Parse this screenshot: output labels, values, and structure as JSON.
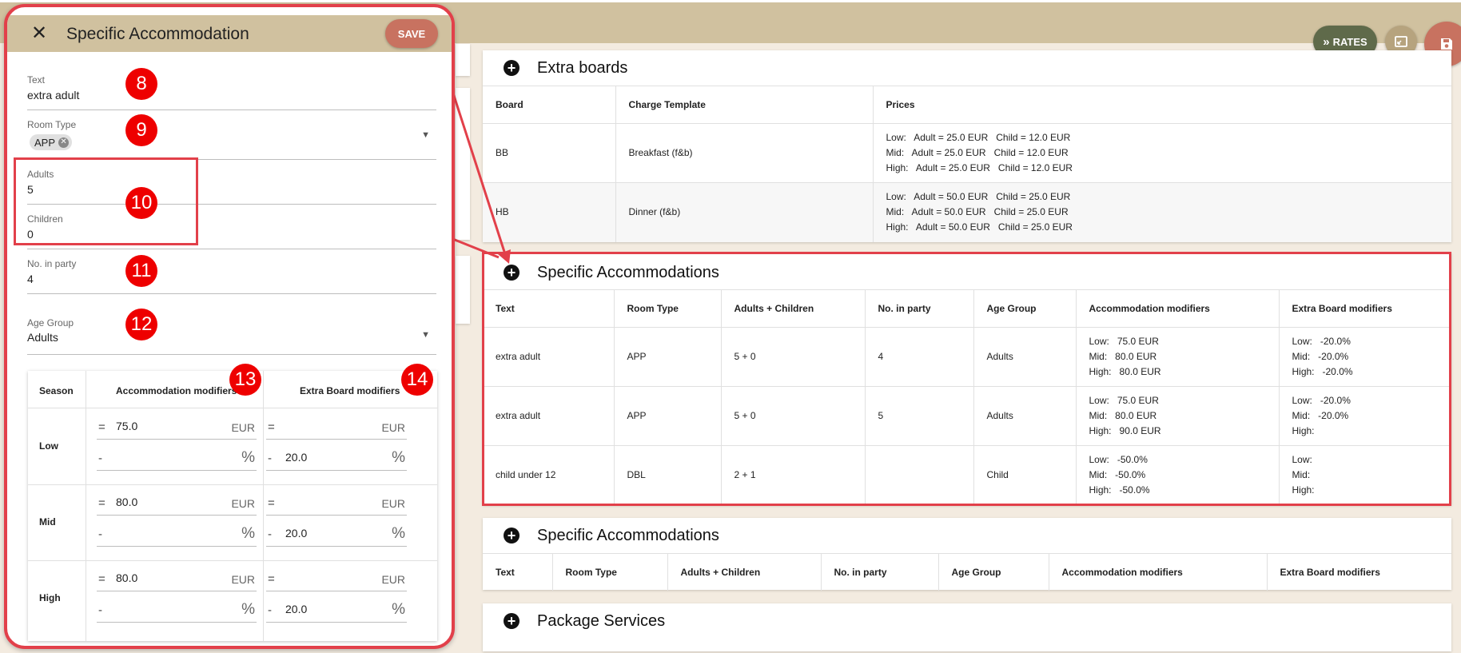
{
  "header": {
    "rates_label": "RATES"
  },
  "extra_boards": {
    "title": "Extra boards",
    "columns": [
      "Board",
      "Charge Template",
      "Prices"
    ],
    "rows": [
      {
        "board": "BB",
        "template": "Breakfast (f&b)",
        "prices": "Low:   Adult = 25.0 EUR   Child = 12.0 EUR\nMid:   Adult = 25.0 EUR   Child = 12.0 EUR\nHigh:   Adult = 25.0 EUR   Child = 12.0 EUR"
      },
      {
        "board": "HB",
        "template": "Dinner (f&b)",
        "prices": "Low:   Adult = 50.0 EUR   Child = 25.0 EUR\nMid:   Adult = 50.0 EUR   Child = 25.0 EUR\nHigh:   Adult = 50.0 EUR   Child = 25.0 EUR"
      }
    ]
  },
  "specific_accommodations": {
    "title": "Specific Accommodations",
    "columns": [
      "Text",
      "Room Type",
      "Adults + Children",
      "No. in party",
      "Age Group",
      "Accommodation modifiers",
      "Extra Board modifiers"
    ],
    "rows": [
      {
        "text": "extra adult",
        "room_type": "APP",
        "adults_children": "5 + 0",
        "party": "4",
        "age_group": "Adults",
        "acc_mod": "Low:   75.0 EUR\nMid:   80.0 EUR\nHigh:   80.0 EUR",
        "board_mod": "Low:   -20.0%\nMid:   -20.0%\nHigh:   -20.0%"
      },
      {
        "text": "extra adult",
        "room_type": "APP",
        "adults_children": "5 + 0",
        "party": "5",
        "age_group": "Adults",
        "acc_mod": "Low:   75.0 EUR\nMid:   80.0 EUR\nHigh:   90.0 EUR",
        "board_mod": "Low:   -20.0%\nMid:   -20.0%\nHigh:"
      },
      {
        "text": "child under 12",
        "room_type": "DBL",
        "adults_children": "2 + 1",
        "party": "",
        "age_group": "Child",
        "acc_mod": "Low:   -50.0%\nMid:   -50.0%\nHigh:   -50.0%",
        "board_mod": "Low:\nMid:\nHigh:"
      }
    ]
  },
  "specific_accommodations_2": {
    "title": "Specific Accommodations",
    "columns": [
      "Text",
      "Room Type",
      "Adults + Children",
      "No. in party",
      "Age Group",
      "Accommodation modifiers",
      "Extra Board modifiers"
    ]
  },
  "package_services": {
    "title": "Package Services"
  },
  "dialog": {
    "title": "Specific Accommodation",
    "save_label": "SAVE",
    "fields": {
      "text": {
        "label": "Text",
        "value": "extra adult"
      },
      "room_type": {
        "label": "Room Type",
        "chip": "APP"
      },
      "adults": {
        "label": "Adults",
        "value": "5"
      },
      "children": {
        "label": "Children",
        "value": "0"
      },
      "party": {
        "label": "No. in party",
        "value": "4"
      },
      "age_group": {
        "label": "Age Group",
        "value": "Adults"
      }
    },
    "season_table": {
      "headers": [
        "Season",
        "Accommodation modifiers",
        "Extra Board modifiers"
      ],
      "rows": [
        {
          "season": "Low",
          "acc_op": "=",
          "acc_value": "75.0",
          "acc_unit": "EUR",
          "acc_pct_op": "-",
          "acc_pct_value": "",
          "acc_pct_unit": "%",
          "board_op": "=",
          "board_value": "",
          "board_unit": "EUR",
          "board_pct_op": "-",
          "board_pct_value": "20.0",
          "board_pct_unit": "%"
        },
        {
          "season": "Mid",
          "acc_op": "=",
          "acc_value": "80.0",
          "acc_unit": "EUR",
          "acc_pct_op": "-",
          "acc_pct_value": "",
          "acc_pct_unit": "%",
          "board_op": "=",
          "board_value": "",
          "board_unit": "EUR",
          "board_pct_op": "-",
          "board_pct_value": "20.0",
          "board_pct_unit": "%"
        },
        {
          "season": "High",
          "acc_op": "=",
          "acc_value": "80.0",
          "acc_unit": "EUR",
          "acc_pct_op": "-",
          "acc_pct_value": "",
          "acc_pct_unit": "%",
          "board_op": "=",
          "board_value": "",
          "board_unit": "EUR",
          "board_pct_op": "-",
          "board_pct_value": "20.0",
          "board_pct_unit": "%"
        }
      ]
    }
  },
  "annotations": {
    "b8": "8",
    "b9": "9",
    "b10": "10",
    "b11": "11",
    "b12": "12",
    "b13": "13",
    "b14": "14"
  },
  "colors": {
    "accent_red": "#e2404a",
    "header_tan": "#d0c19f",
    "save_button": "#c87260",
    "rates_button": "#5f6a4a"
  }
}
